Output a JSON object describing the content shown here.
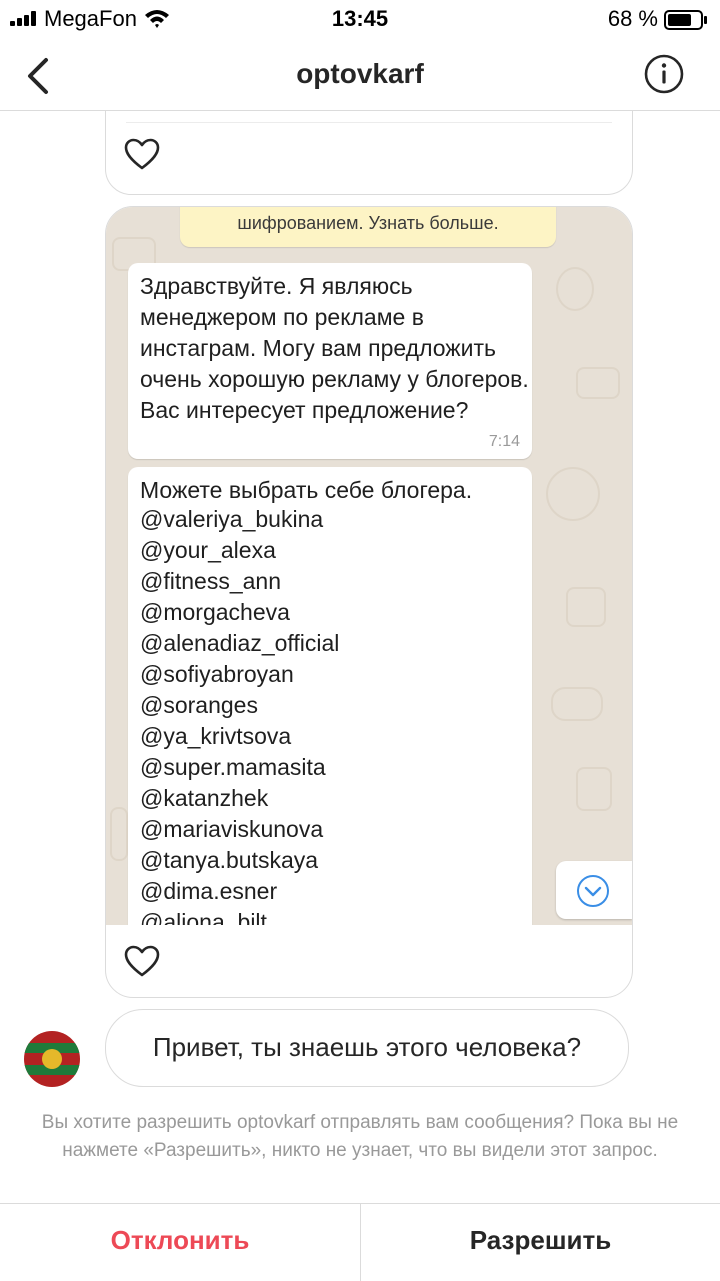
{
  "status_bar": {
    "carrier": "MegaFon",
    "time": "13:45",
    "battery": "68 %"
  },
  "header": {
    "title": "optovkarf",
    "back_icon": "chevron-left-icon",
    "info_icon": "info-icon"
  },
  "thread": {
    "screenshot": {
      "system_note": "шифрованием. Узнать больше.",
      "message_1": {
        "text": "Здравствуйте. Я являюсь менеджером по рекламе в инстаграм. Могу вам предложить очень хорошую рекламу у блогеров. Вас интересует предложение?",
        "time": "7:14"
      },
      "message_2": {
        "intro": "Можете выбрать себе блогера.",
        "handles": [
          "@valeriya_bukina",
          "@your_alexa",
          "@fitness_ann",
          "@morgacheva",
          "@alenadiaz_official",
          "@sofiyabroyan",
          "@soranges",
          "@ya_krivtsova",
          "@super.mamasita",
          "@katanzhek",
          "@mariaviskunova",
          "@tanya.butskaya",
          "@dima.esner",
          "@aliona_bilt"
        ]
      }
    },
    "incoming_message": "Привет, ты знаешь этого человека?"
  },
  "request": {
    "notice": "Вы хотите разрешить optovkarf отправлять вам сообщения? Пока вы не нажмете «Разрешить», никто не узнает, что вы видели этот запрос."
  },
  "actions": {
    "decline": "Отклонить",
    "allow": "Разрешить"
  },
  "colors": {
    "decline": "#ed4956",
    "chat_background": "#e7e0d6",
    "system_note": "#fdf4c5",
    "scroll_button": "#3a8ee6"
  }
}
